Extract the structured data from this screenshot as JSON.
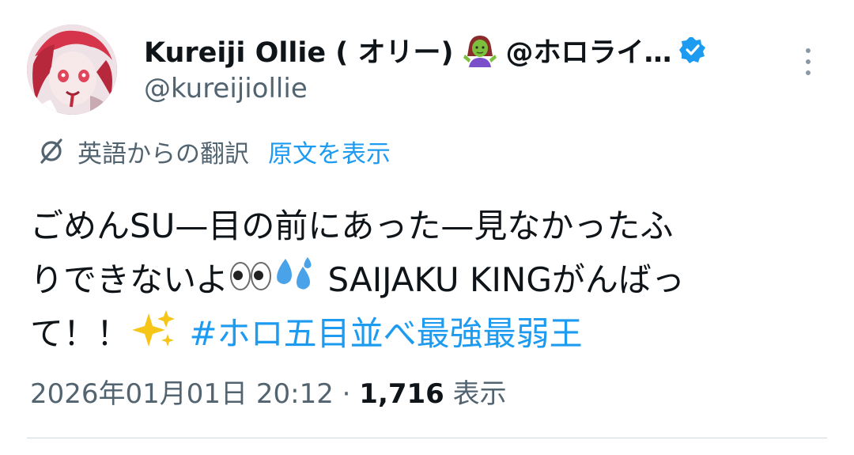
{
  "author": {
    "display_name": "Kureiji Ollie ( オリー)",
    "handle_suffix": "@ホロライ…",
    "handle": "@kureijiollie",
    "verified": true
  },
  "icons": {
    "avatar": "avatar",
    "zombie": "zombie-woman-icon",
    "verified": "verified-badge-icon",
    "more": "more-options-icon",
    "translate": "translate-icon",
    "eyes": "eyes-icon",
    "sweat": "sweat-droplets-icon",
    "sparkles": "sparkles-icon"
  },
  "translation": {
    "label": "英語からの翻訳",
    "original_link": "原文を表示"
  },
  "body": {
    "line1": "ごめんSU—目の前にあった—見なかったふ",
    "line2_a": "りできないよ",
    "line2_b": " SAIJAKU KINGがんばっ",
    "line3_a": "て！！",
    "hashtag": "#ホロ五目並べ最強最弱王"
  },
  "meta": {
    "timestamp": "2026年01月01日 20:12",
    "separator": " · ",
    "views_count": "1,716",
    "views_label": " 表示"
  },
  "colors": {
    "link": "#1d9bf0",
    "secondary_text": "#536471",
    "primary_text": "#0f1419"
  }
}
